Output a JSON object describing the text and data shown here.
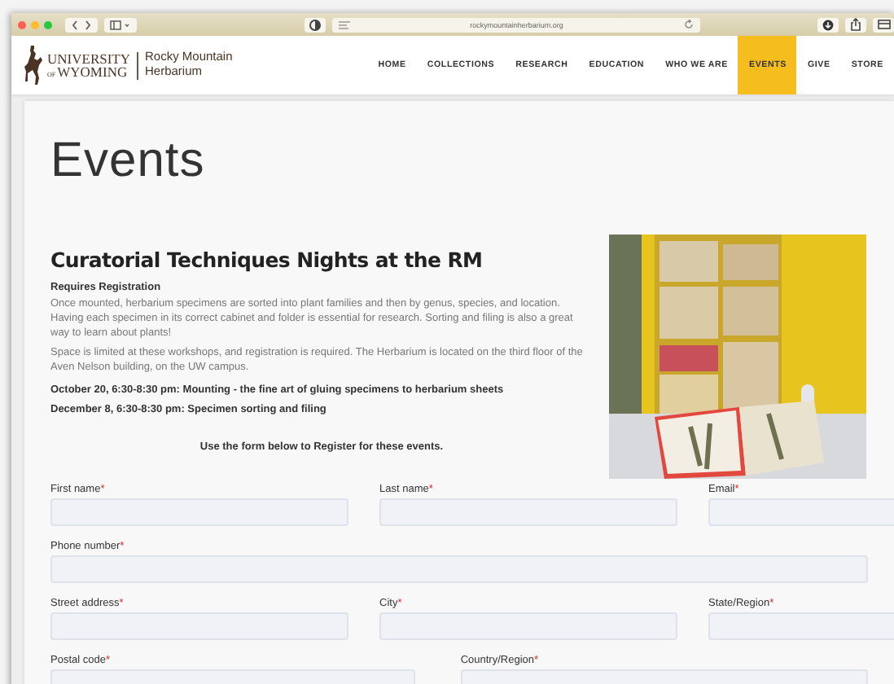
{
  "browser": {
    "url": "rockymountainherbarium.org"
  },
  "header": {
    "logo": {
      "university": "UNIVERSITY",
      "of": "OF",
      "wyoming": "WYOMING",
      "site_line_1": "Rocky Mountain",
      "site_line_2": "Herbarium"
    },
    "nav": [
      {
        "label": "HOME",
        "selected": false
      },
      {
        "label": "COLLECTIONS",
        "selected": false
      },
      {
        "label": "RESEARCH",
        "selected": false
      },
      {
        "label": "EDUCATION",
        "selected": false
      },
      {
        "label": "WHO WE ARE",
        "selected": false
      },
      {
        "label": "EVENTS",
        "selected": true
      },
      {
        "label": "GIVE",
        "selected": false
      },
      {
        "label": "STORE",
        "selected": false
      }
    ]
  },
  "page_title": "Events",
  "event": {
    "heading": "Curatorial Techniques Nights at the RM",
    "subheading": "Requires Registration",
    "paragraphs": [
      "Once mounted, herbarium specimens are sorted into plant families and then by genus, species, and location. Having each specimen in its correct cabinet and folder is essential for research. Sorting and filing is also a great way to learn about plants!",
      "Space is limited at these workshops, and registration is required. The Herbarium is located on the third floor of the Aven Nelson building, on the UW campus."
    ],
    "dates": [
      "October 20, 6:30-8:30 pm: Mounting - the fine art of gluing specimens to herbarium sheets",
      "December 8, 6:30-8:30 pm: Specimen sorting and filing"
    ],
    "form_intro": "Use the form below to Register for these events.",
    "photo": {
      "kind": "picture"
    }
  },
  "form": {
    "rows": [
      [
        {
          "label": "First name",
          "required_mark": "*"
        },
        {
          "label": "Last name",
          "required_mark": "*"
        },
        {
          "label": "Email",
          "required_mark": "*"
        }
      ],
      [
        {
          "label": "Phone number",
          "required_mark": "*"
        }
      ],
      [
        {
          "label": "Street address",
          "required_mark": "*"
        },
        {
          "label": "City",
          "required_mark": "*"
        },
        {
          "label": "State/Region",
          "required_mark": "*"
        }
      ],
      [
        {
          "label": "Postal code",
          "required_mark": "*"
        },
        {
          "label": "Country/Region",
          "required_mark": "*"
        }
      ]
    ]
  }
}
